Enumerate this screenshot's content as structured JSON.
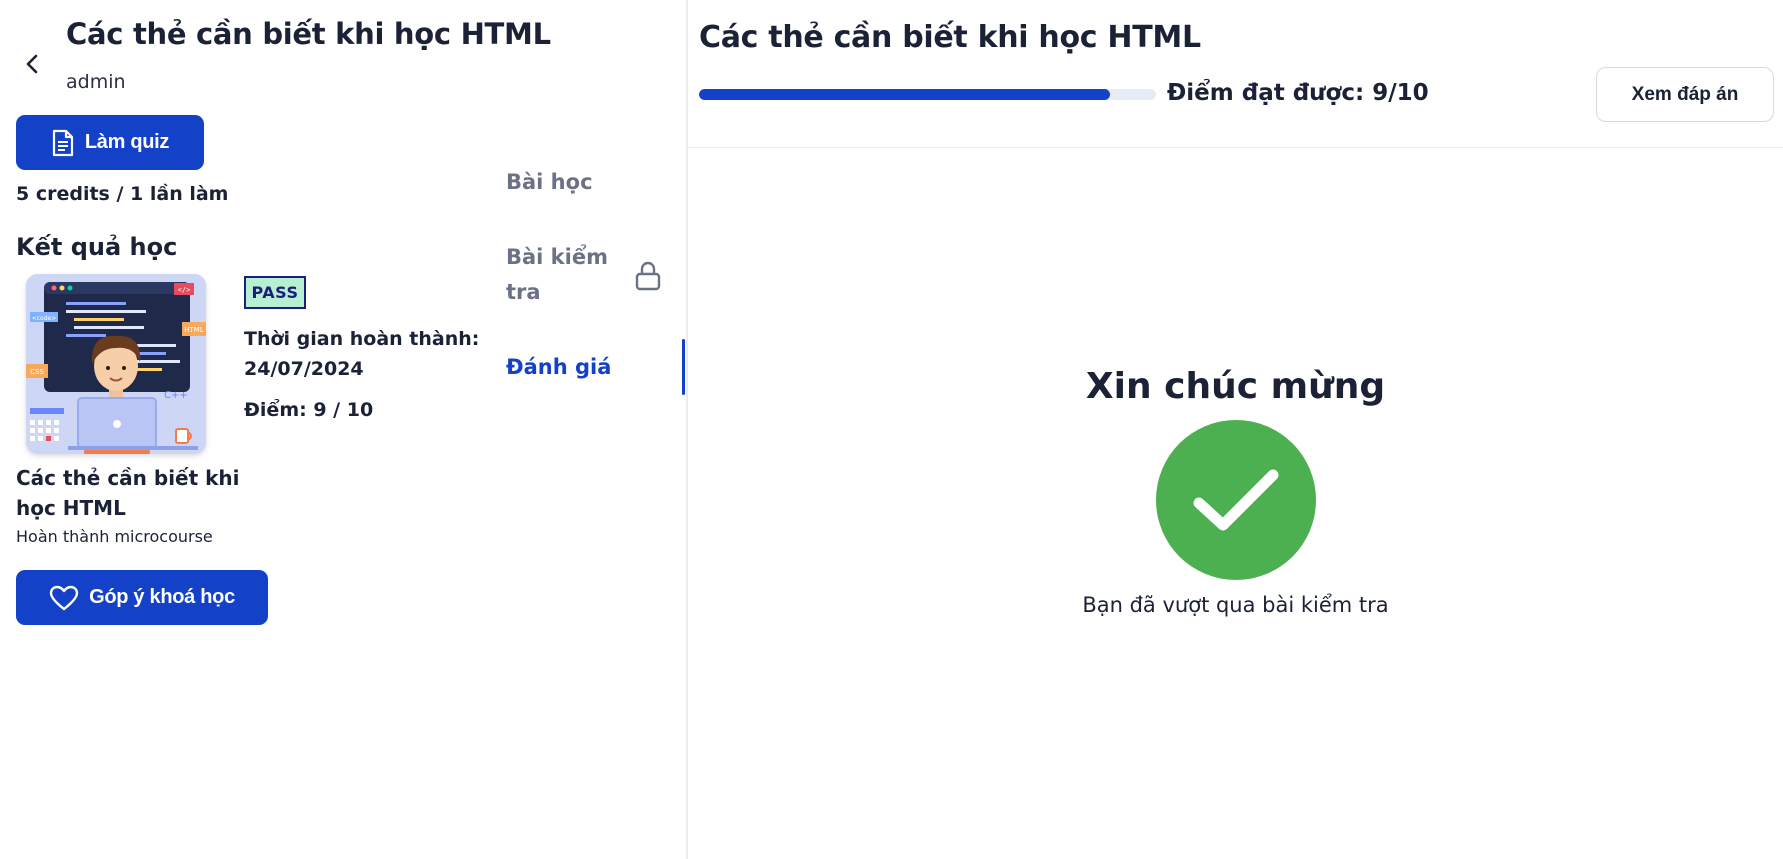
{
  "left": {
    "course_title": "Các thẻ cần biết khi học HTML",
    "author": "admin",
    "quiz_button_label": "Làm quiz",
    "credits_text": "5 credits / 1 lần làm",
    "results_title": "Kết quả học",
    "result": {
      "status_badge": "PASS",
      "completion_label": "Thời gian hoàn thành:",
      "completion_date": "24/07/2024",
      "score_text": "Điểm: 9 / 10",
      "card_title_line1": "Các thẻ cần biết khi",
      "card_title_line2": "học HTML",
      "card_subtitle": "Hoàn thành microcourse"
    },
    "feedback_button_label": "Góp ý khoá học"
  },
  "nav": {
    "lessons_label": "Bài học",
    "tests_label": "Bài kiểm tra",
    "evaluation_label": "Đánh giá",
    "active": "evaluation"
  },
  "right": {
    "quiz_title": "Các thẻ cần biết khi học HTML",
    "progress": 0.9,
    "score_label": "Điểm đạt được: 9/10",
    "view_answers_label": "Xem đáp án",
    "congrats_title": "Xin chúc mừng",
    "passed_message": "Bạn đã vượt qua bài kiểm tra"
  },
  "colors": {
    "primary": "#1341c7",
    "success": "#4caf50",
    "pass_badge_bg": "#b6efd2",
    "text_dark": "#1b2236",
    "nav_inactive": "#6b7285"
  },
  "icons": {
    "back": "chevron-left-icon",
    "quiz": "document-icon",
    "feedback": "heart-icon",
    "lock": "lock-icon",
    "success": "checkmark-icon"
  }
}
